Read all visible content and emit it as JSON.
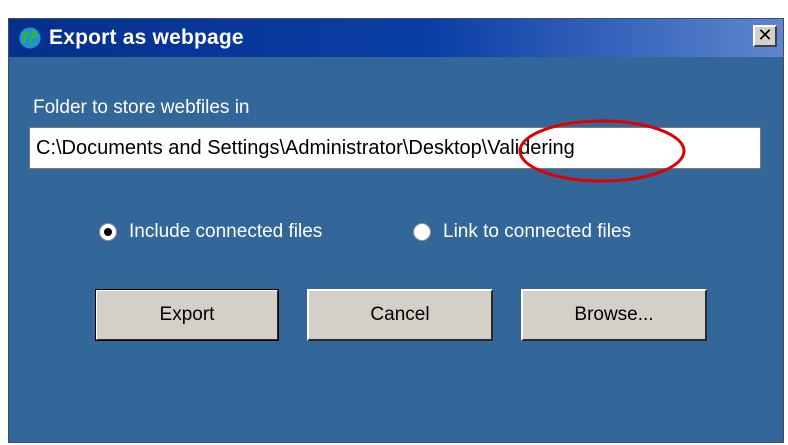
{
  "window": {
    "title": "Export as webpage",
    "close_label": "✕",
    "title_icon": "globe-icon",
    "colors": {
      "body_bg": "#336699",
      "titlebar_start": "#062f8c",
      "titlebar_end": "#5f86cf",
      "button_face": "#d4d0c8",
      "annotation": "#e00000"
    }
  },
  "folder": {
    "label": "Folder to store webfiles in",
    "value": "C:\\Documents and Settings\\Administrator\\Desktop\\Validering"
  },
  "options": {
    "include_label": "Include connected files",
    "link_label": "Link to connected files",
    "selected": "include"
  },
  "buttons": {
    "export_label": "Export",
    "cancel_label": "Cancel",
    "browse_label": "Browse..."
  }
}
